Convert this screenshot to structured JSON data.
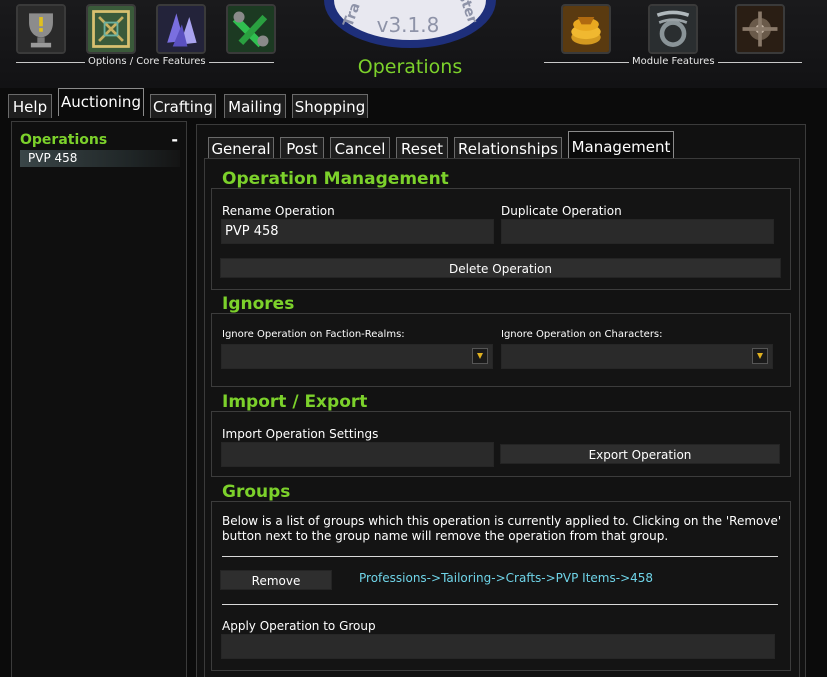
{
  "header": {
    "left_group_label": "Options / Core Features",
    "right_group_label": "Module Features",
    "logo_version": "v3.1.8",
    "logo_text": "TradeSkillMaster",
    "current_section": "Operations",
    "left_icons": [
      "trophy-icon",
      "rune-panel-icon",
      "crystal-icon",
      "wrench-icon"
    ],
    "right_icons": [
      "gold-coins-icon",
      "metal-coil-icon",
      "engineering-gear-icon"
    ]
  },
  "module_tabs": [
    {
      "label": "Help",
      "active": false
    },
    {
      "label": "Auctioning",
      "active": true
    },
    {
      "label": "Crafting",
      "active": false
    },
    {
      "label": "Mailing",
      "active": false
    },
    {
      "label": "Shopping",
      "active": false
    }
  ],
  "sidebar": {
    "header": "Operations",
    "collapse_symbol": "-",
    "items": [
      {
        "label": "PVP 458",
        "selected": true
      }
    ]
  },
  "op_tabs": [
    {
      "label": "General",
      "active": false
    },
    {
      "label": "Post",
      "active": false
    },
    {
      "label": "Cancel",
      "active": false
    },
    {
      "label": "Reset",
      "active": false
    },
    {
      "label": "Relationships",
      "active": false
    },
    {
      "label": "Management",
      "active": true
    }
  ],
  "management": {
    "title": "Operation Management",
    "rename_label": "Rename Operation",
    "rename_value": "PVP 458",
    "duplicate_label": "Duplicate Operation",
    "duplicate_value": "",
    "delete_button": "Delete Operation"
  },
  "ignores": {
    "title": "Ignores",
    "faction_label": "Ignore Operation on Faction-Realms:",
    "faction_value": "",
    "characters_label": "Ignore Operation on Characters:",
    "characters_value": ""
  },
  "import_export": {
    "title": "Import / Export",
    "import_label": "Import Operation Settings",
    "import_value": "",
    "export_button": "Export Operation"
  },
  "groups": {
    "title": "Groups",
    "description": "Below is a list of groups which this operation is currently applied to. Clicking on the 'Remove' button next to the group name will remove the operation from that group.",
    "remove_button": "Remove",
    "group_path": "Professions->Tailoring->Crafts->PVP Items->458",
    "apply_label": "Apply Operation to Group",
    "apply_value": ""
  },
  "colors": {
    "accent_green": "#7cd12b",
    "group_path_cyan": "#6fd4e8"
  }
}
